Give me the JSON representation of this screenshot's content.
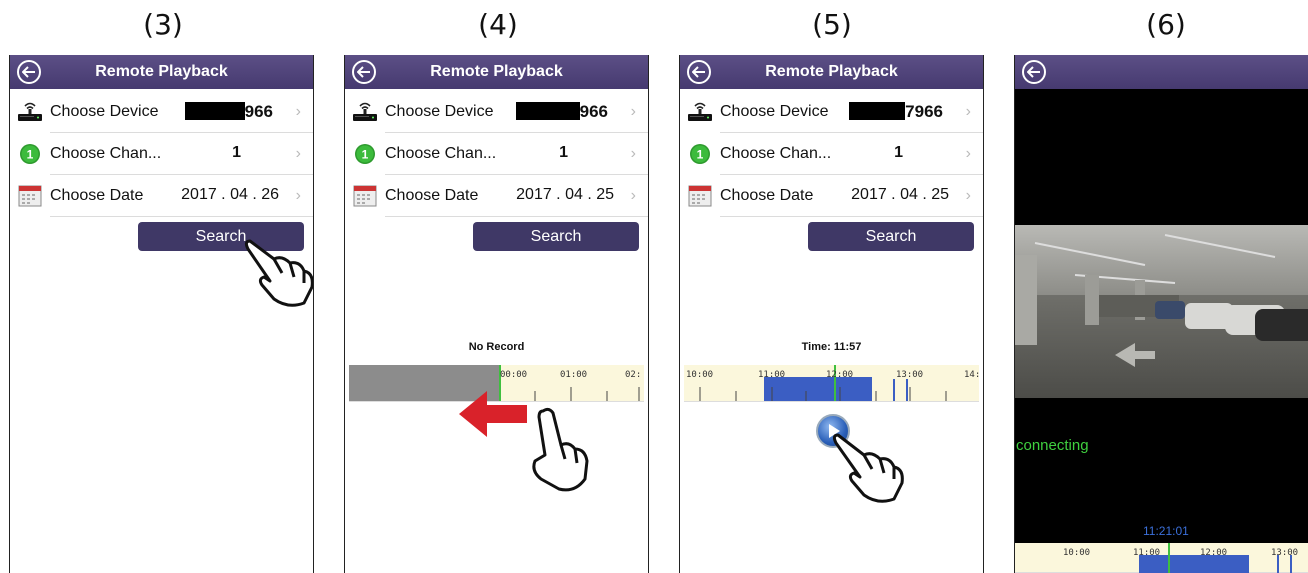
{
  "steps": [
    "(3)",
    "(4)",
    "(5)",
    "(6)"
  ],
  "app": {
    "title": "Remote Playback"
  },
  "screens": [
    {
      "device_label": "Choose Device",
      "device_value": "966",
      "channel_label": "Choose Chan...",
      "channel_value": "1",
      "date_label": "Choose Date",
      "date_value": "2017 . 04 . 26",
      "search_label": "Search"
    },
    {
      "device_label": "Choose Device",
      "device_value": "966",
      "channel_label": "Choose Chan...",
      "channel_value": "1",
      "date_label": "Choose Date",
      "date_value": "2017 . 04 . 25",
      "search_label": "Search",
      "timeline_caption": "No Record",
      "timeline_ticks": [
        "00:00",
        "01:00",
        "02:"
      ]
    },
    {
      "device_label": "Choose Device",
      "device_value": "7966",
      "channel_label": "Choose Chan...",
      "channel_value": "1",
      "date_label": "Choose Date",
      "date_value": "2017 . 04 . 25",
      "search_label": "Search",
      "timeline_caption": "Time: 11:57",
      "timeline_ticks": [
        "10:00",
        "11:00",
        "12:00",
        "13:00",
        "14:"
      ]
    },
    {
      "status_text": "connecting",
      "timestamp": "11:21:01",
      "timeline_ticks": [
        "10:00",
        "11:00",
        "12:00",
        "13:00"
      ]
    }
  ],
  "colors": {
    "navbar": "#4f4379",
    "search_button": "#3f3866",
    "recording_bar": "#3b5ec3",
    "cursor_line": "#3fbf3f",
    "status_text": "#3fcf3f",
    "arrow": "#d9222a"
  },
  "icons": [
    "back-icon",
    "router-icon",
    "channel-badge-icon",
    "calendar-icon",
    "play-icon",
    "pointing-hand-icon",
    "swipe-left-arrow-icon"
  ]
}
